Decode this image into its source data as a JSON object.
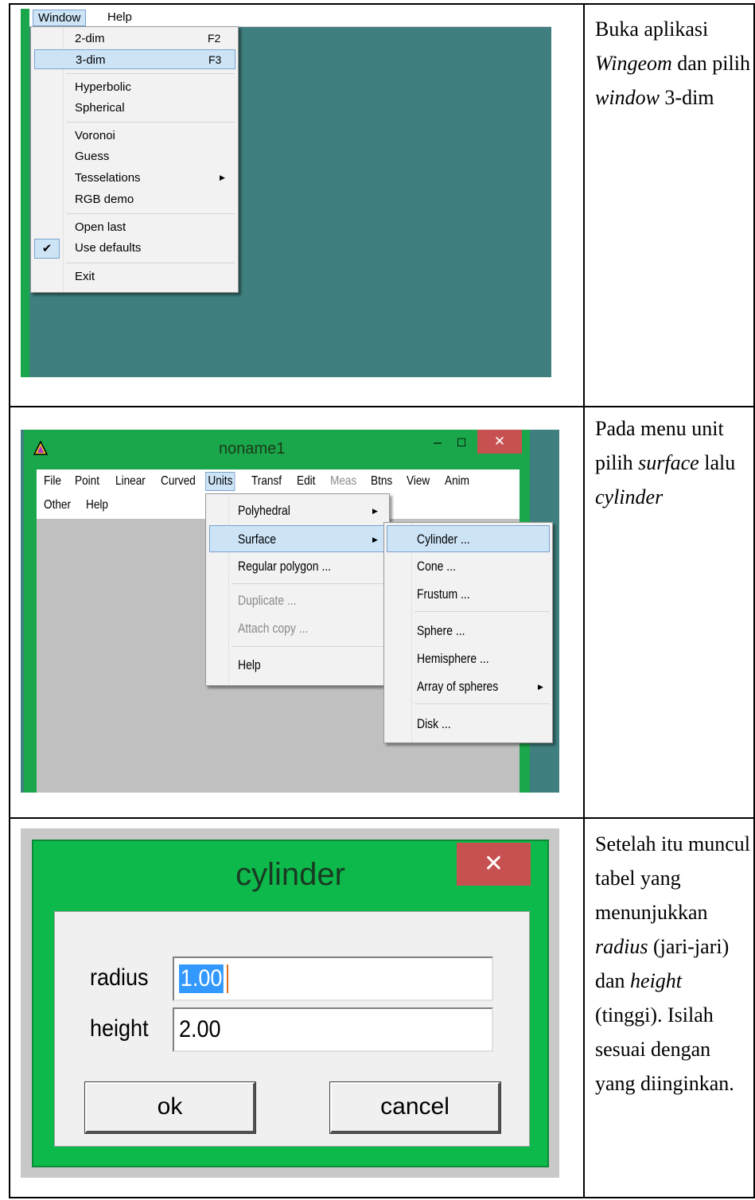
{
  "rows": [
    {
      "description_parts": [
        {
          "text": "Buka aplikasi ",
          "italic": false
        },
        {
          "text": "Wingeom",
          "italic": true
        },
        {
          "text": " dan pilih ",
          "italic": false
        },
        {
          "text": "window",
          "italic": true
        },
        {
          "text": " 3-dim",
          "italic": false
        }
      ]
    },
    {
      "description_parts": [
        {
          "text": "Pada menu unit pilih ",
          "italic": false
        },
        {
          "text": "surface",
          "italic": true
        },
        {
          "text": " lalu ",
          "italic": false
        },
        {
          "text": "cylinder",
          "italic": true
        }
      ]
    },
    {
      "description_parts": [
        {
          "text": "Setelah itu muncul tabel yang menunjukkan ",
          "italic": false
        },
        {
          "text": "radius",
          "italic": true
        },
        {
          "text": " (jari-jari) dan ",
          "italic": false
        },
        {
          "text": "height",
          "italic": true
        },
        {
          "text": " (tinggi). Isilah sesuai dengan yang diinginkan.",
          "italic": false
        }
      ]
    }
  ],
  "shot1": {
    "menubar": {
      "window": "Window",
      "help": "Help"
    },
    "menu": {
      "dim2": "2-dim",
      "dim2_shortcut": "F2",
      "dim3": "3-dim",
      "dim3_shortcut": "F3",
      "hyperbolic": "Hyperbolic",
      "spherical": "Spherical",
      "voronoi": "Voronoi",
      "guess": "Guess",
      "tesselations": "Tesselations",
      "rgb_demo": "RGB demo",
      "open_last": "Open last",
      "use_defaults": "Use defaults",
      "exit": "Exit"
    }
  },
  "shot2": {
    "title": "noname1",
    "menubar": [
      "File",
      "Point",
      "Linear",
      "Curved",
      "Units",
      "Transf",
      "Edit",
      "Meas",
      "Btns",
      "View",
      "Anim",
      "Other",
      "Help"
    ],
    "units_menu": {
      "polyhedral": "Polyhedral",
      "surface": "Surface",
      "regular_polygon": "Regular polygon ...",
      "duplicate": "Duplicate ...",
      "attach_copy": "Attach copy ...",
      "help": "Help"
    },
    "surface_menu": {
      "cylinder": "Cylinder ...",
      "cone": "Cone ...",
      "frustum": "Frustum ...",
      "sphere": "Sphere ...",
      "hemisphere": "Hemisphere ...",
      "array_of_spheres": "Array of spheres",
      "disk": "Disk ..."
    }
  },
  "shot3": {
    "title": "cylinder",
    "radius_label": "radius",
    "radius_value": "1.00",
    "height_label": "height",
    "height_value": "2.00",
    "ok": "ok",
    "cancel": "cancel"
  },
  "colors": {
    "desktop_teal": "#3f7f7f",
    "window_green": "#1aa64a",
    "dialog_green": "#0db94a",
    "close_red": "#c75050",
    "menu_highlight": "#cde4f7",
    "selection_blue": "#3399ff"
  }
}
